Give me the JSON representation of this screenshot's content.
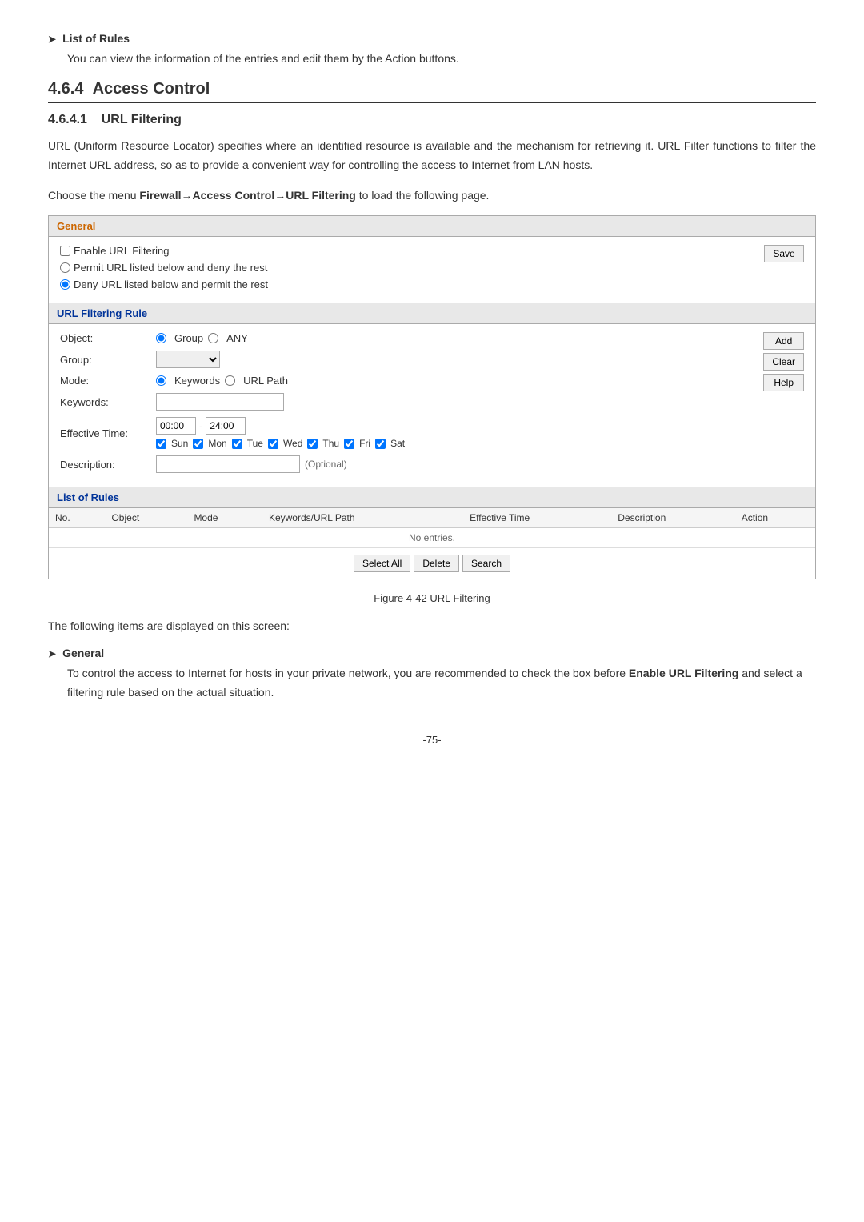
{
  "list_of_rules_heading": "List of Rules",
  "list_of_rules_desc": "You can view the information of the entries and edit them by the Action buttons.",
  "section_number": "4.6.4",
  "section_title": "Access Control",
  "subsection_number": "4.6.4.1",
  "subsection_title": "URL Filtering",
  "intro_paragraph": "URL (Uniform Resource Locator) specifies where an identified resource is available and the mechanism for retrieving it. URL Filter functions to filter the Internet URL address, so as to provide a convenient way for controlling the access to Internet from LAN hosts.",
  "menu_instruction_prefix": "Choose the menu ",
  "menu_instruction_path": "Firewall→Access Control→URL Filtering",
  "menu_instruction_suffix": " to load the following page.",
  "general_panel": {
    "header": "General",
    "enable_label": "Enable URL Filtering",
    "radio1_label": "Permit URL listed below and deny the rest",
    "radio2_label": "Deny URL listed below and permit the rest",
    "save_button": "Save"
  },
  "url_filtering_rule_panel": {
    "header": "URL Filtering Rule",
    "object_label": "Object:",
    "object_radio1": "Group",
    "object_radio2": "ANY",
    "group_label": "Group:",
    "mode_label": "Mode:",
    "mode_radio1": "Keywords",
    "mode_radio2": "URL Path",
    "keywords_label": "Keywords:",
    "effective_time_label": "Effective Time:",
    "time_from": "00:00",
    "time_separator": "-",
    "time_to": "24:00",
    "days": [
      "Sun",
      "Mon",
      "Tue",
      "Wed",
      "Thu",
      "Fri",
      "Sat"
    ],
    "days_checked": [
      true,
      true,
      true,
      true,
      true,
      true,
      true
    ],
    "description_label": "Description:",
    "description_optional": "(Optional)",
    "add_button": "Add",
    "clear_button": "Clear",
    "help_button": "Help"
  },
  "list_of_rules_panel": {
    "header": "List of Rules",
    "columns": [
      "No.",
      "Object",
      "Mode",
      "Keywords/URL Path",
      "Effective Time",
      "Description",
      "Action"
    ],
    "no_entries": "No entries.",
    "select_all_button": "Select All",
    "delete_button": "Delete",
    "search_button": "Search"
  },
  "figure_caption": "Figure 4-42 URL Filtering",
  "following_items_text": "The following items are displayed on this screen:",
  "general_section_heading": "General",
  "general_section_desc_prefix": "To control the access to Internet for hosts in your private network, you are recommended to check the box before ",
  "general_section_desc_bold": "Enable URL Filtering",
  "general_section_desc_suffix": " and select a filtering rule based on the actual situation.",
  "page_number": "-75-"
}
